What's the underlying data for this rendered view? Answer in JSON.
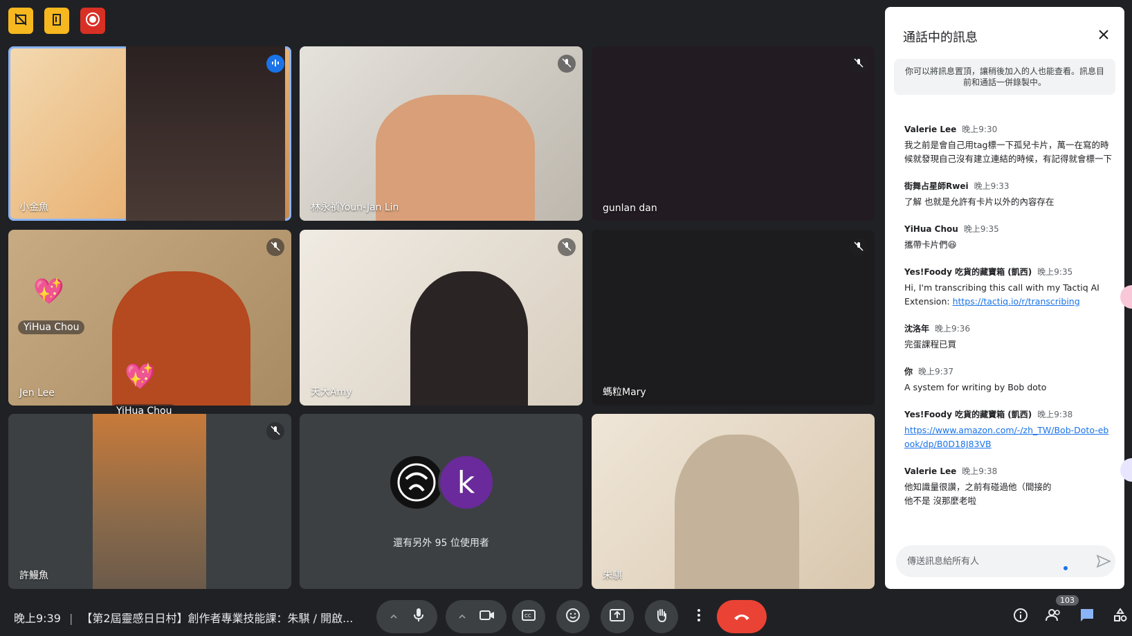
{
  "tiles": [
    {
      "name": "小金魚",
      "speaking": true
    },
    {
      "name": "林永禎Youn-Jan Lin"
    },
    {
      "name": "gunlan dan"
    },
    {
      "name": "Jen Lee"
    },
    {
      "name": "天大Amy"
    },
    {
      "name": "螞粒Mary"
    },
    {
      "name": "許鰻魚"
    },
    {
      "name": "朱騏"
    }
  ],
  "reactions": {
    "label_top": "YiHua Chou",
    "label_bottom": "YiHua Chou"
  },
  "others": {
    "avatar_letter": "k",
    "text": "還有另外 95 位使用者"
  },
  "chat": {
    "title": "通話中的訊息",
    "pin_note": "你可以將訊息置頂，讓稍後加入的人也能查看。訊息目前和通話一併錄製中。",
    "messages": [
      {
        "sender": "Valerie Lee",
        "time": "晚上9:30",
        "body": "我之前是會自己用tag標一下孤兒卡片，萬一在寫的時候就發現自己沒有建立連結的時候，有記得就會標一下"
      },
      {
        "sender": "街舞占星師Rwei",
        "time": "晚上9:33",
        "body": "了解 也就是允許有卡片以外的內容存在"
      },
      {
        "sender": "YiHua Chou",
        "time": "晚上9:35",
        "body": "攜帶卡片們😆"
      },
      {
        "sender": "Yes!Foody 吃貨的藏寶箱 (凱西)",
        "time": "晚上9:35",
        "body": "Hi, I'm transcribing this call with my Tactiq AI Extension: ",
        "link": "https://tactiq.io/r/transcribing"
      },
      {
        "sender": "沈洛年",
        "time": "晚上9:36",
        "body": "完蛋課程已買"
      },
      {
        "sender": "你",
        "time": "晚上9:37",
        "body": "A system for writing by Bob doto"
      },
      {
        "sender": "Yes!Foody 吃貨的藏寶箱 (凱西)",
        "time": "晚上9:38",
        "body": "",
        "link": "https://www.amazon.com/-/zh_TW/Bob-Doto-ebook/dp/B0D18J83VB"
      },
      {
        "sender": "Valerie Lee",
        "time": "晚上9:38",
        "body": "他知識量很讚，之前有碰過他（間接的\n他不是 沒那麼老啦"
      }
    ],
    "input_placeholder": "傳送訊息給所有人"
  },
  "bottom": {
    "time": "晚上9:39",
    "meeting_title": "【第2屆靈感日日村】創作者專業技能課：朱騏 / 開啟...",
    "participant_count": "103"
  },
  "colors": {
    "accent": "#1a73e8",
    "end_call": "#ea4335",
    "record": "#d93025",
    "warn": "#f6b81e"
  }
}
